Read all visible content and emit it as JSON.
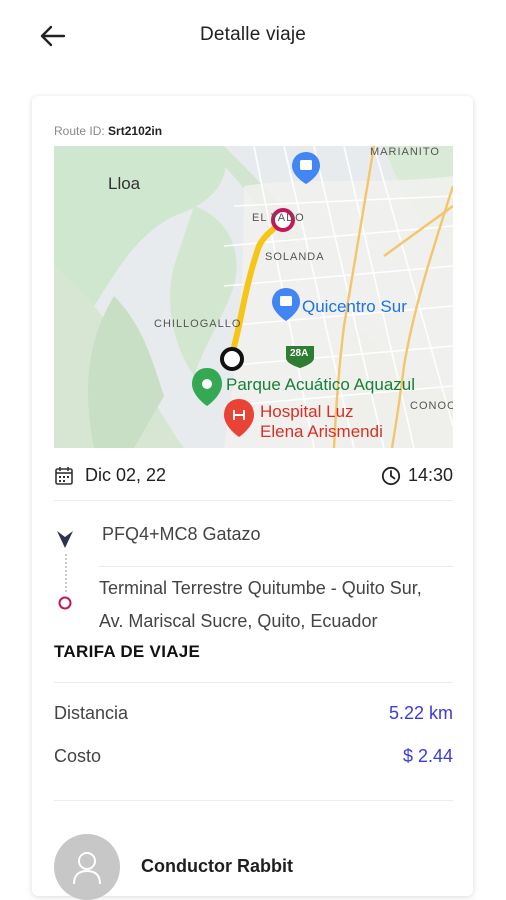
{
  "header": {
    "title": "Detalle viaje"
  },
  "trip": {
    "route_id_label": "Route ID:",
    "route_id": "Srt2102in",
    "date": "Dic 02, 22",
    "time": "14:30"
  },
  "map": {
    "labels": {
      "marianito": "MARIANITO",
      "lloa": "Lloa",
      "el_tado": "EL TADO",
      "solanda": "SOLANDA",
      "quicentro": "Quicentro Sur",
      "chillogallo": "CHILLOGALLO",
      "badge_28a": "28A",
      "parque": "Parque Acuático Aquazul",
      "hospital_1": "Hospital Luz",
      "hospital_2": "Elena Arismendi",
      "conoc": "CONOC"
    },
    "colors": {
      "route": "#f5c518",
      "start_marker": "#222222",
      "end_marker": "#c2185b",
      "park_green": "#34a853",
      "hospital_red": "#ea4335",
      "shop_blue": "#4285f4"
    }
  },
  "route": {
    "origin": "PFQ4+MC8 Gatazo",
    "destination_line1": "Terminal Terrestre Quitumbe - Quito Sur,",
    "destination_line2": "Av. Mariscal Sucre, Quito, Ecuador"
  },
  "fare": {
    "title": "TARIFA DE VIAJE",
    "distance_label": "Distancia",
    "distance_value": "5.22 km",
    "cost_label": "Costo",
    "cost_value": "$ 2.44",
    "value_color": "#3b3bd9"
  },
  "driver": {
    "name": "Conductor Rabbit"
  }
}
